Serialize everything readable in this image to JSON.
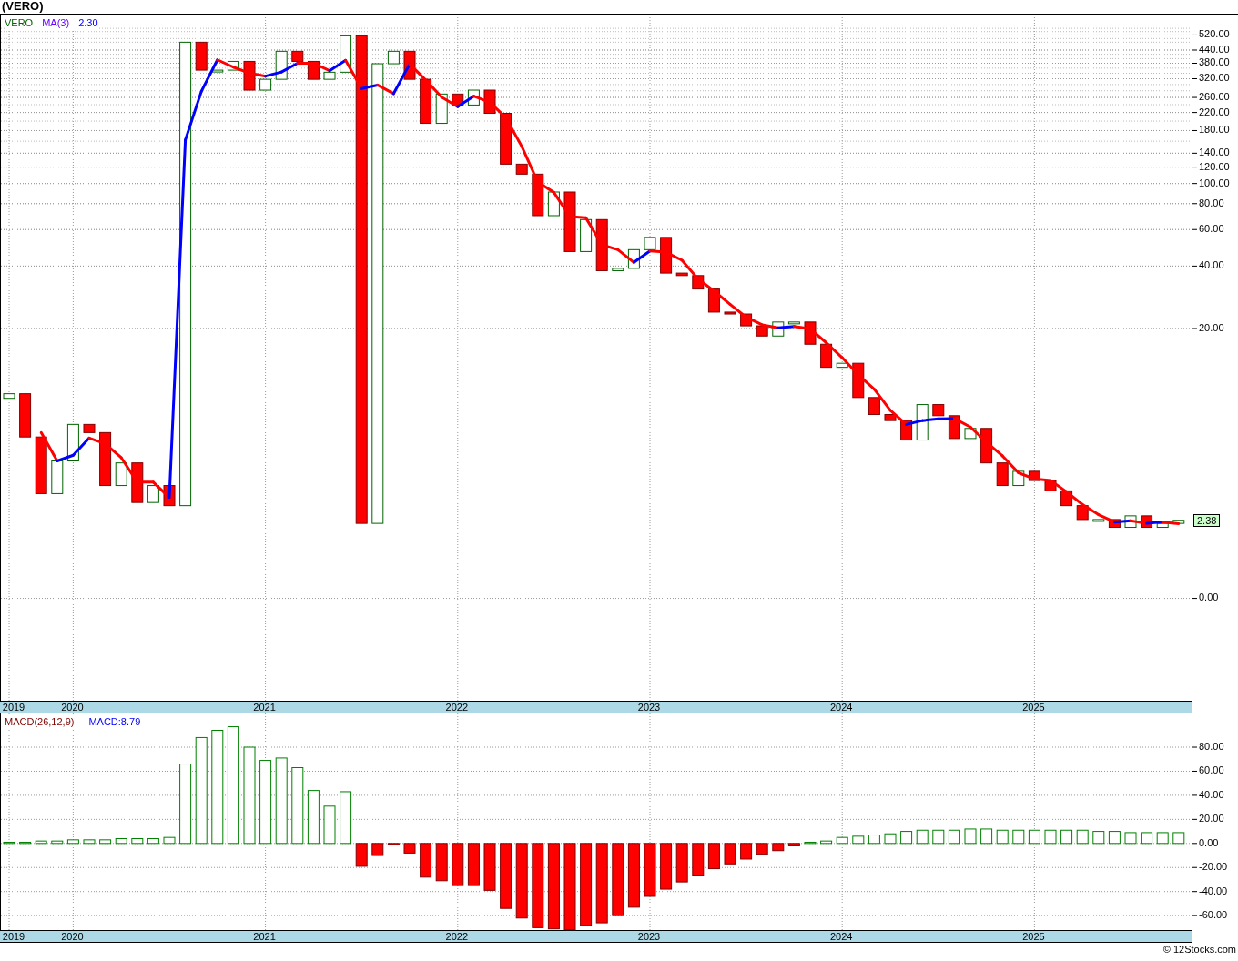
{
  "title": "(VERO)",
  "price_panel": {
    "legend": [
      {
        "text": "VERO",
        "color": "#006400"
      },
      {
        "text": "MA(3)",
        "color": "#6a00ff"
      },
      {
        "text": "2.30",
        "color": "#0000ff"
      }
    ],
    "axis_labels": [
      "520.00",
      "440.00",
      "380.00",
      "320.00",
      "260.00",
      "220.00",
      "180.00",
      "140.00",
      "120.00",
      "100.00",
      "80.00",
      "60.00",
      "40.00",
      "20.00",
      "0.00"
    ],
    "last_price": "2.38",
    "date_axis": [
      "2019",
      "2020",
      "2021",
      "2022",
      "2023",
      "2024",
      "2025"
    ]
  },
  "macd_panel": {
    "legend": [
      {
        "text": "MACD(26,12,9)",
        "color": "#800000"
      },
      {
        "text": "MACD:8.79",
        "color": "#0000ff"
      }
    ],
    "chart_data": {
      "type": "bar",
      "stacked": true,
      "grid": true,
      "series": [
        {
          "color": "#008000",
          "values": [
            1,
            1,
            2,
            2,
            3,
            3,
            3,
            4,
            4,
            4,
            5,
            66,
            88,
            94,
            97,
            80,
            69,
            71,
            63,
            44,
            31,
            43,
            null,
            null,
            null,
            null,
            null,
            null,
            null,
            null,
            null,
            null,
            null,
            null,
            null,
            null,
            null,
            null,
            null,
            null,
            null,
            null,
            null,
            null,
            null,
            null,
            null,
            null,
            null,
            null,
            1,
            2,
            5,
            6,
            7,
            8,
            10,
            11,
            11,
            11,
            12,
            12,
            11,
            11,
            11,
            11,
            11,
            11,
            10,
            10,
            9,
            9,
            9,
            9
          ]
        },
        {
          "color": "#ff0000",
          "values": [
            null,
            null,
            null,
            null,
            null,
            null,
            null,
            null,
            null,
            null,
            null,
            null,
            null,
            null,
            null,
            null,
            null,
            null,
            null,
            null,
            null,
            null,
            -19,
            -10,
            -1,
            -8,
            -28,
            -31,
            -35,
            -35,
            -39,
            -54,
            -62,
            -70,
            -71,
            -72,
            -68,
            -66,
            -60,
            -53,
            -44,
            -38,
            -32,
            -27,
            -21,
            -17,
            -13,
            -9,
            -6,
            -2,
            null,
            null,
            null,
            null,
            null,
            null,
            null,
            null,
            null,
            null,
            null,
            null,
            null,
            null,
            null,
            null,
            null,
            null,
            null,
            null,
            null,
            null,
            null,
            null
          ]
        }
      ],
      "ylim": [
        -72,
        108
      ],
      "yticks": [
        {
          "value": 80,
          "label": "80.00"
        },
        {
          "value": 60,
          "label": "60.00"
        },
        {
          "value": 40,
          "label": "40.00"
        },
        {
          "value": 20,
          "label": "20.00"
        },
        {
          "value": 0,
          "label": "0.00"
        },
        {
          "value": -20,
          "label": "-20.00"
        },
        {
          "value": -40,
          "label": "-40.00"
        },
        {
          "value": -60,
          "label": "-60.00"
        }
      ]
    },
    "date_axis": [
      "2019",
      "2020",
      "2021",
      "2022",
      "2023",
      "2024",
      "2025"
    ]
  },
  "footer": "© 12Stocks.com"
}
